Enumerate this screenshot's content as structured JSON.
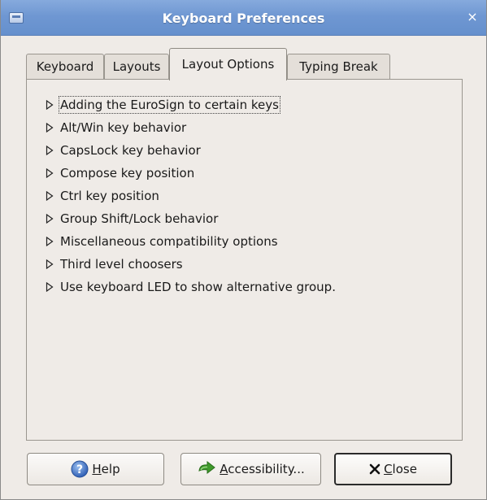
{
  "window": {
    "title": "Keyboard Preferences",
    "close_glyph": "×"
  },
  "tabs": [
    {
      "label": "Keyboard",
      "active": false
    },
    {
      "label": "Layouts",
      "active": false
    },
    {
      "label": "Layout Options",
      "active": true
    },
    {
      "label": "Typing Break",
      "active": false
    }
  ],
  "options": [
    "Adding the EuroSign to certain keys",
    "Alt/Win key behavior",
    "CapsLock key behavior",
    "Compose key position",
    "Ctrl key position",
    "Group Shift/Lock behavior",
    "Miscellaneous compatibility options",
    "Third level choosers",
    "Use keyboard LED to show alternative group."
  ],
  "buttons": {
    "help": {
      "mnemonic": "H",
      "rest": "elp",
      "icon": "help-icon"
    },
    "accessibility": {
      "mnemonic": "A",
      "rest": "ccessibility...",
      "icon": "accessibility-icon"
    },
    "close": {
      "mnemonic": "C",
      "rest": "lose",
      "icon": "close-x-icon"
    }
  },
  "colors": {
    "titlebar": "#6f97d2",
    "window_bg": "#efebe7",
    "help_icon_blue": "#3b6fc2",
    "accessibility_icon_green": "#3f9a2c"
  }
}
